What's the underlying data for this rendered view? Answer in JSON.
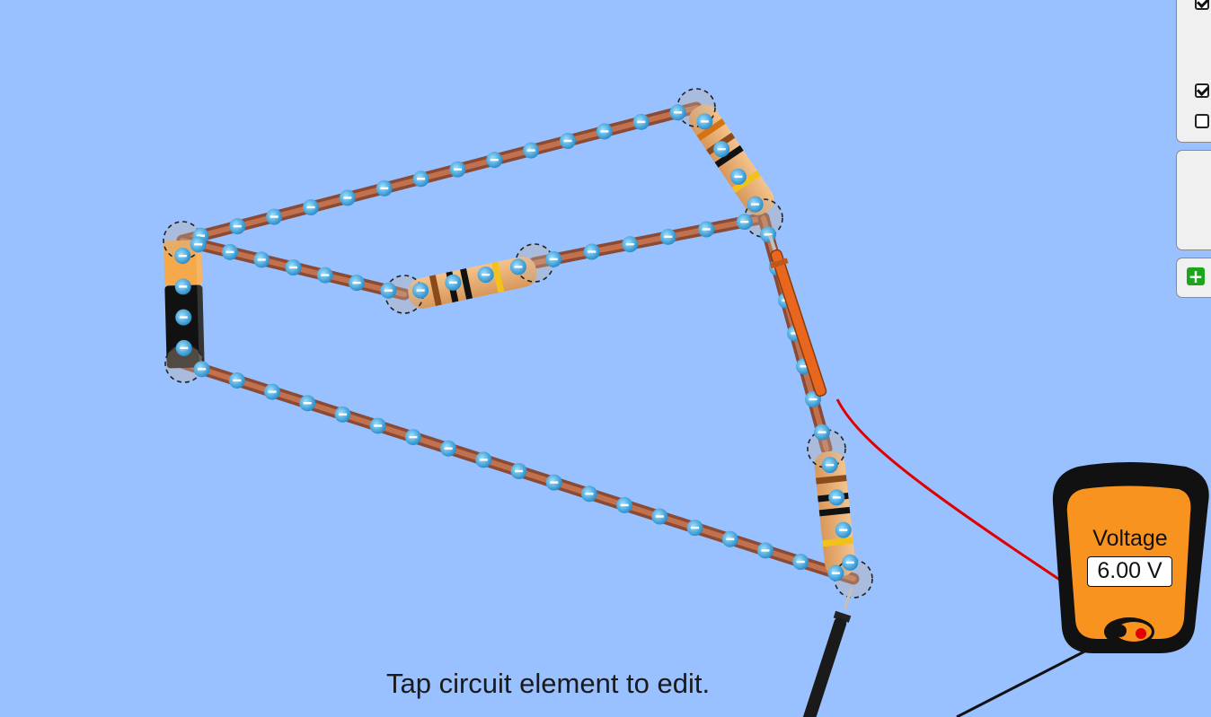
{
  "hint_text": "Tap circuit element to edit.",
  "control_panel": {
    "checkboxes": [
      {
        "checked": true
      },
      {
        "checked": true
      },
      {
        "checked": false
      }
    ]
  },
  "add_button": {
    "icon": "plus-icon"
  },
  "voltmeter": {
    "title": "Voltage",
    "reading": "6.00 V",
    "body_color": "#f7931e",
    "red_probe_color": "#e8661d",
    "black_probe_color": "#1a1a1a"
  },
  "colors": {
    "background": "#99c0ff",
    "wire": "#c2714f",
    "electron": "#3aa6e0"
  }
}
